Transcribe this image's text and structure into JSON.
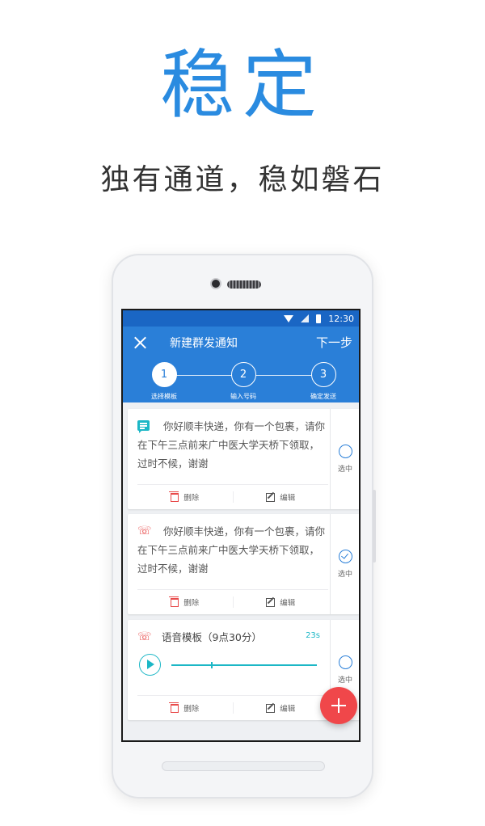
{
  "hero": {
    "title": "稳定",
    "subtitle": "独有通道，稳如磐石"
  },
  "status_bar": {
    "time": "12:30",
    "icons": [
      "wifi-icon",
      "signal-icon",
      "battery-icon"
    ]
  },
  "app_bar": {
    "title": "新建群发通知",
    "next_label": "下一步",
    "close_icon": "close-icon"
  },
  "steps": [
    {
      "number": "1",
      "label": "选择模板",
      "active": true
    },
    {
      "number": "2",
      "label": "输入号码",
      "active": false
    },
    {
      "number": "3",
      "label": "确定发送",
      "active": false
    }
  ],
  "cards": [
    {
      "type": "sms",
      "icon": "message-icon",
      "text": "你好顺丰快递，你有一个包裹，请你在下午三点前来广中医大学天桥下领取，过时不候，谢谢",
      "select_label": "选中",
      "selected": false,
      "delete_label": "删除",
      "edit_label": "编辑"
    },
    {
      "type": "voice-call",
      "icon": "phone-call-icon",
      "text": "你好顺丰快递，你有一个包裹，请你在下午三点前来广中医大学天桥下领取，过时不候，谢谢",
      "select_label": "选中",
      "selected": true,
      "delete_label": "删除",
      "edit_label": "编辑"
    },
    {
      "type": "voice",
      "icon": "phone-call-icon",
      "title": "语音模板（9点30分）",
      "duration": "23s",
      "progress": 0.27,
      "select_label": "选中",
      "selected": false,
      "delete_label": "删除",
      "edit_label": "编辑"
    }
  ],
  "colors": {
    "accent": "#2a7fd8",
    "status_bar": "#1a66c4",
    "teal": "#1cb7c6",
    "red": "#e84a4a",
    "fab": "#f0474a"
  }
}
